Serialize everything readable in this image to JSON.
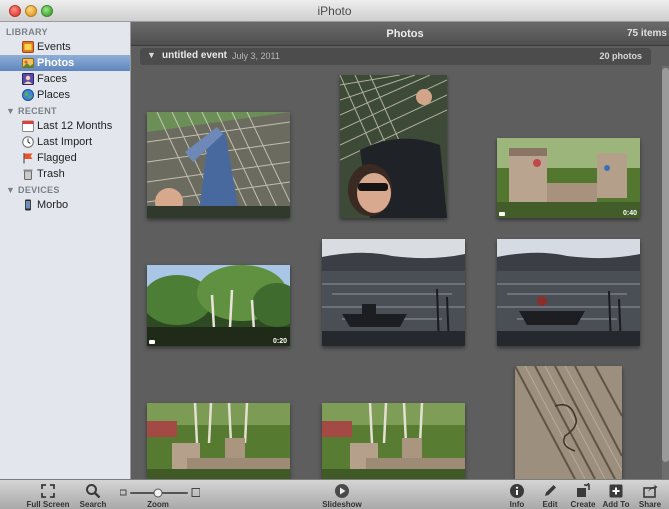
{
  "window": {
    "title": "iPhoto"
  },
  "sidebar": {
    "library_heading": "LIBRARY",
    "library": [
      {
        "label": "Events",
        "icon": "events-icon"
      },
      {
        "label": "Photos",
        "icon": "photos-icon",
        "selected": true
      },
      {
        "label": "Faces",
        "icon": "faces-icon"
      },
      {
        "label": "Places",
        "icon": "places-icon"
      }
    ],
    "recent_heading": "RECENT",
    "recent": [
      {
        "label": "Last 12 Months",
        "icon": "calendar-icon"
      },
      {
        "label": "Last Import",
        "icon": "clock-icon"
      },
      {
        "label": "Flagged",
        "icon": "flag-icon"
      },
      {
        "label": "Trash",
        "icon": "trash-icon"
      }
    ],
    "devices_heading": "DEVICES",
    "devices": [
      {
        "label": "Morbo",
        "icon": "iphone-icon"
      }
    ]
  },
  "content": {
    "title": "Photos",
    "item_count": "75 items",
    "event": {
      "name": "untitled event",
      "date": "July 3, 2011",
      "count": "20 photos"
    },
    "videos": {
      "video_1_duration": "0:40",
      "video_2_duration": "0:20"
    }
  },
  "toolbar": {
    "full_screen": "Full Screen",
    "search": "Search",
    "zoom": "Zoom",
    "slideshow": "Slideshow",
    "info": "Info",
    "edit": "Edit",
    "create": "Create",
    "add_to": "Add To",
    "share": "Share"
  },
  "colors": {
    "selection": "#5f86bd",
    "sidebar_bg": "#e3e7ed",
    "content_bg": "#5e5e5e"
  }
}
